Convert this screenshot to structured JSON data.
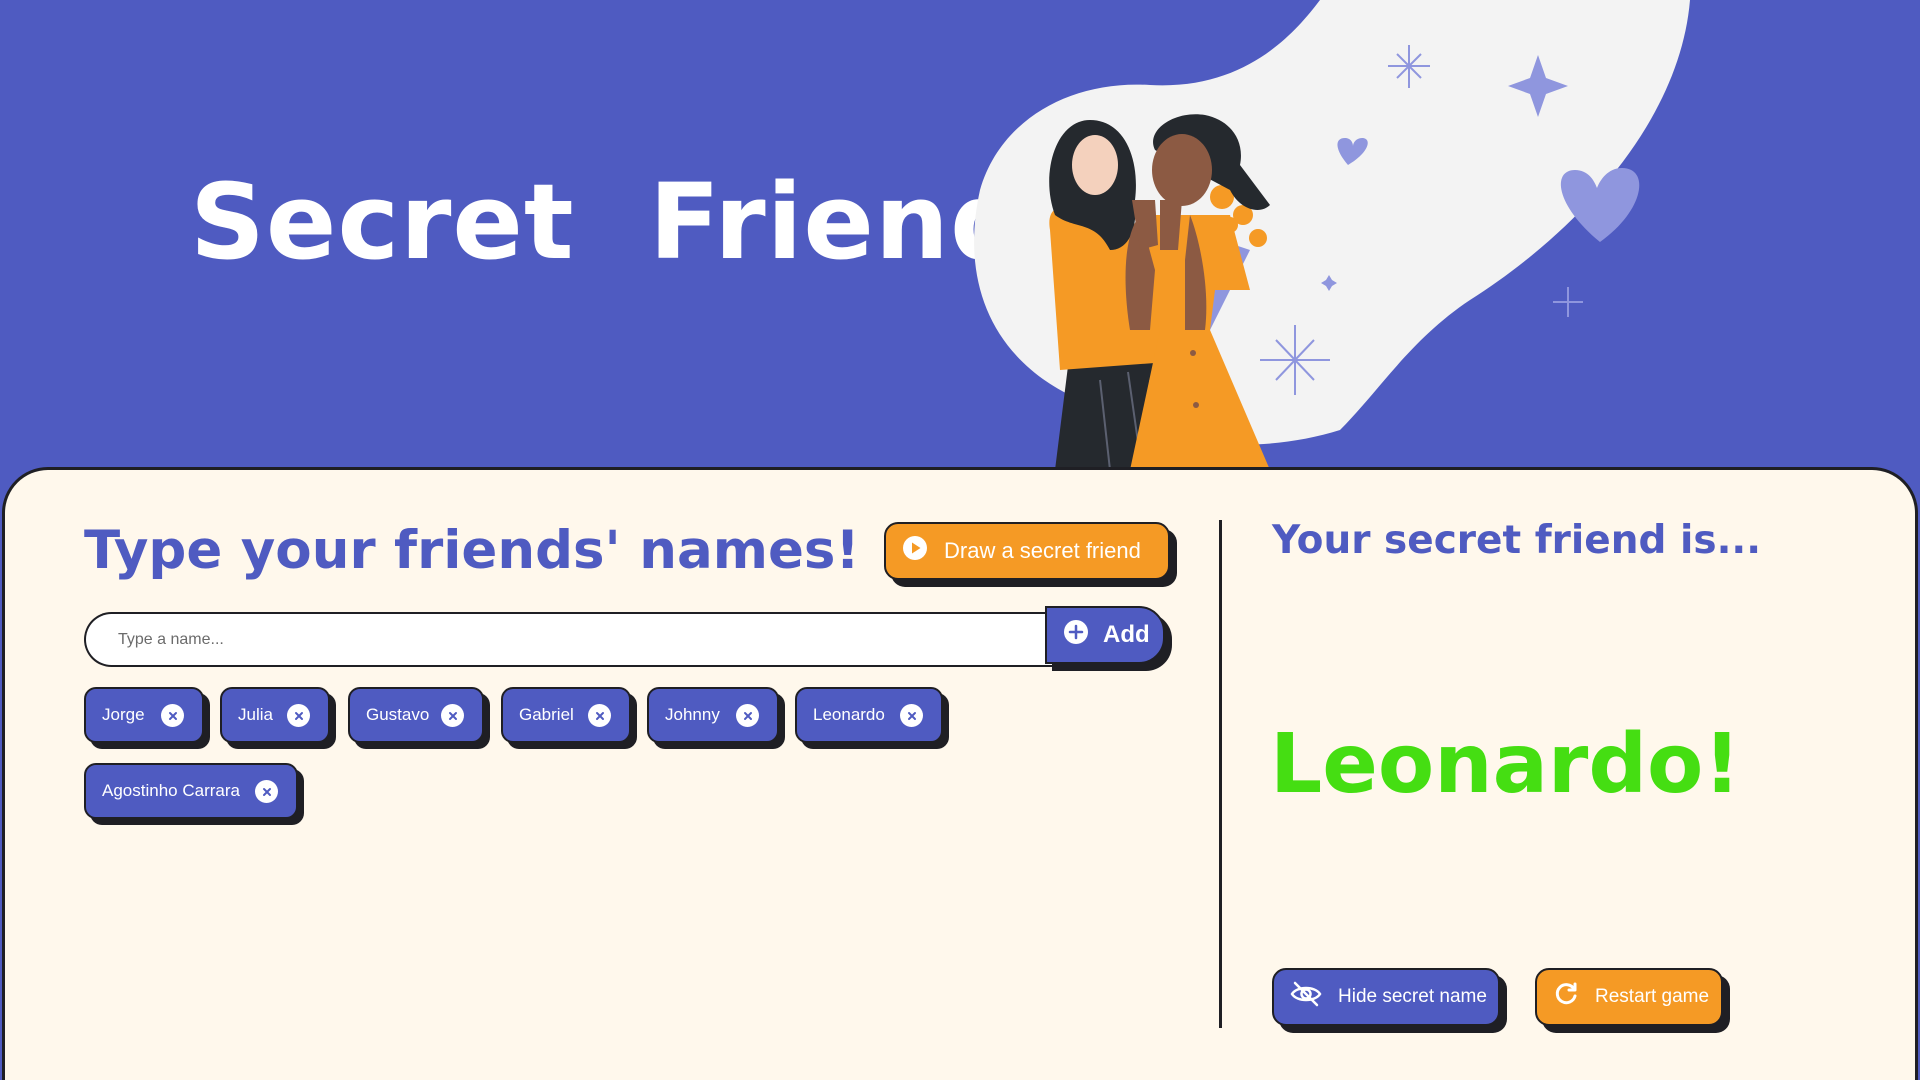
{
  "hero": {
    "title": "Secret  Friend"
  },
  "colors": {
    "primary": "#4f5bc1",
    "accent": "#f59a25",
    "card_bg": "#fff8ec",
    "winner": "#45de12",
    "ink": "#1f1f24"
  },
  "left": {
    "title": "Type your friends' names!",
    "draw_button": {
      "label": "Draw a secret friend",
      "icon": "play-circle-icon"
    },
    "input": {
      "placeholder": "Type a name...",
      "value": ""
    },
    "add_button": {
      "label": "Add",
      "icon": "plus-circle-icon"
    },
    "friends": [
      {
        "name": "Jorge",
        "remove_icon": "close-icon"
      },
      {
        "name": "Julia",
        "remove_icon": "close-icon"
      },
      {
        "name": "Gustavo",
        "remove_icon": "close-icon"
      },
      {
        "name": "Gabriel",
        "remove_icon": "close-icon"
      },
      {
        "name": "Johnny",
        "remove_icon": "close-icon"
      },
      {
        "name": "Leonardo",
        "remove_icon": "close-icon"
      },
      {
        "name": "Agostinho Carrara",
        "remove_icon": "close-icon"
      }
    ]
  },
  "right": {
    "title": "Your secret friend is...",
    "result": "Leonardo!",
    "hide_button": {
      "label": "Hide secret name",
      "icon": "eye-off-icon"
    },
    "restart_button": {
      "label": "Restart game",
      "icon": "refresh-icon"
    }
  }
}
